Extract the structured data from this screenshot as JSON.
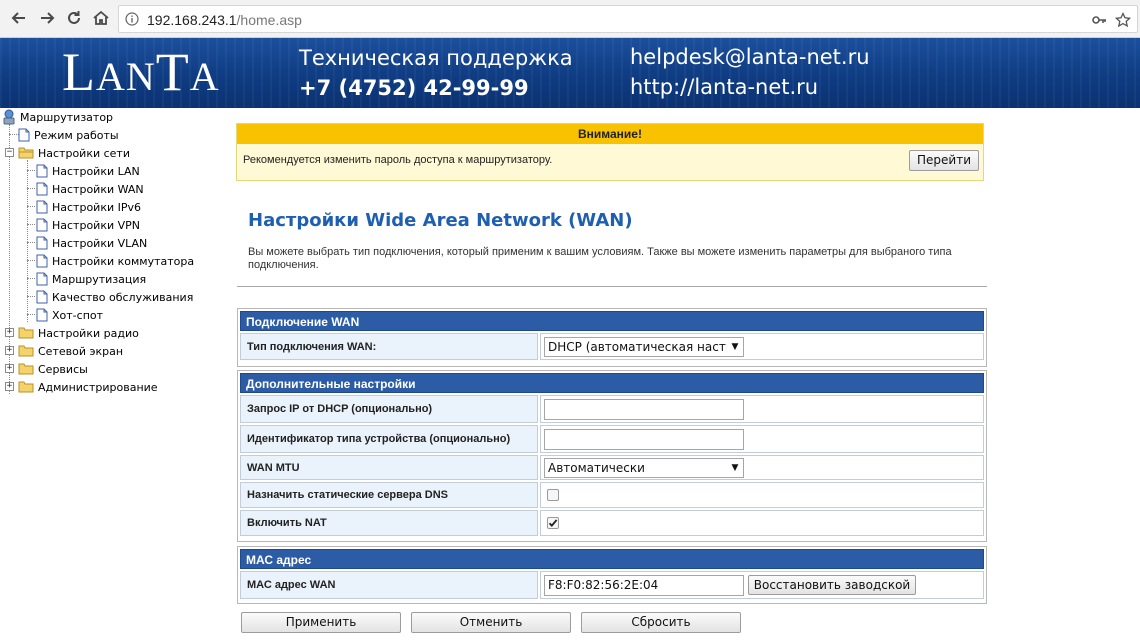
{
  "browser": {
    "url_host": "192.168.243.1",
    "url_path": "/home.asp"
  },
  "banner": {
    "logo": "LanTa",
    "support_title": "Техническая поддержка",
    "support_phone": "+7 (4752) 42-99-99",
    "email": "helpdesk@lanta-net.ru",
    "website": "http://lanta-net.ru"
  },
  "tree": {
    "root": "Маршрутизатор",
    "items": [
      {
        "label": "Режим работы",
        "icon": "page-icon"
      },
      {
        "label": "Настройки сети",
        "icon": "folder-open-icon"
      },
      {
        "label": "Настройки LAN",
        "icon": "page-icon"
      },
      {
        "label": "Настройки WAN",
        "icon": "page-icon"
      },
      {
        "label": "Настройки IPv6",
        "icon": "page-icon"
      },
      {
        "label": "Настройки VPN",
        "icon": "page-icon"
      },
      {
        "label": "Настройки VLAN",
        "icon": "page-icon"
      },
      {
        "label": "Настройки коммутатора",
        "icon": "page-icon"
      },
      {
        "label": "Маршрутизация",
        "icon": "page-icon"
      },
      {
        "label": "Качество обслуживания",
        "icon": "page-icon"
      },
      {
        "label": "Хот-спот",
        "icon": "page-icon"
      },
      {
        "label": "Настройки радио",
        "icon": "folder-icon"
      },
      {
        "label": "Сетевой экран",
        "icon": "folder-icon"
      },
      {
        "label": "Сервисы",
        "icon": "folder-icon"
      },
      {
        "label": "Администрирование",
        "icon": "folder-icon"
      }
    ]
  },
  "alert": {
    "title": "Внимание!",
    "text": "Рекомендуется изменить пароль доступа к маршрутизатору.",
    "button": "Перейти"
  },
  "page": {
    "title": "Настройки Wide Area Network (WAN)",
    "description": "Вы можете выбрать тип подключения, который применим к вашим условиям. Также вы можете изменить параметры для выбраного типа подключения."
  },
  "wan_section": {
    "header": "Подключение WAN",
    "type_label": "Тип подключения WAN:",
    "type_value": "DHCP (автоматическая настр"
  },
  "extra_section": {
    "header": "Дополнительные настройки",
    "dhcp_ip_label": "Запрос IP от DHCP (опционально)",
    "dhcp_ip_value": "",
    "device_id_label": "Идентификатор типа устройства (опционально)",
    "device_id_value": "",
    "mtu_label": "WAN MTU",
    "mtu_value": "Автоматически",
    "static_dns_label": "Назначить статические сервера DNS",
    "static_dns_checked": false,
    "nat_label": "Включить NAT",
    "nat_checked": true
  },
  "mac_section": {
    "header": "МАС адрес",
    "mac_label": "МАС адрес WAN",
    "mac_value": "F8:F0:82:56:2E:04",
    "restore_button": "Восстановить заводской"
  },
  "buttons": {
    "apply": "Применить",
    "cancel": "Отменить",
    "reset": "Сбросить"
  },
  "colors": {
    "banner_blue": "#0f3c82",
    "section_header": "#2b5ca5",
    "alert_header": "#f8c200",
    "title_blue": "#1f5fb0"
  }
}
